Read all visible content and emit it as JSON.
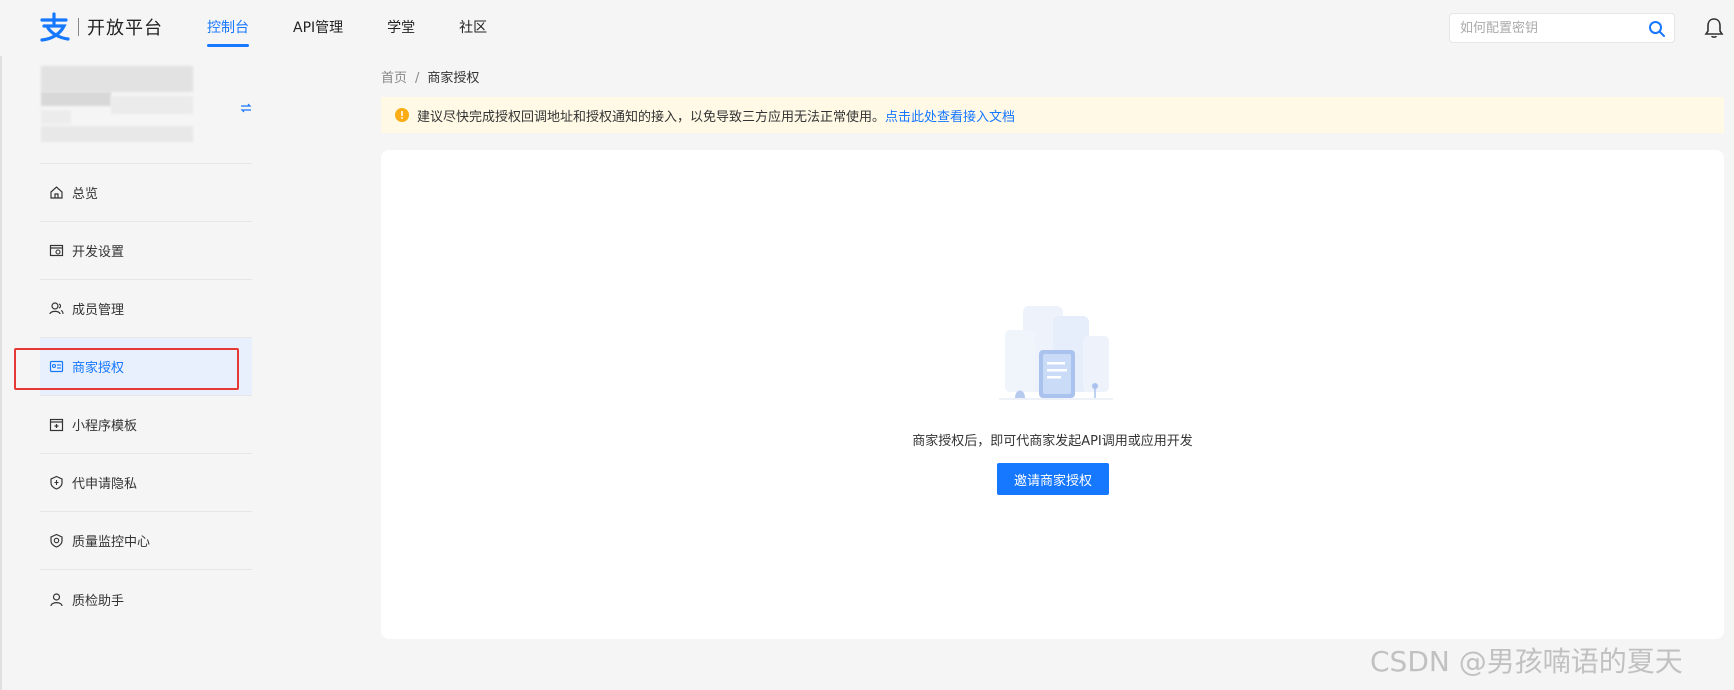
{
  "header": {
    "brand": "开放平台",
    "nav": [
      {
        "label": "控制台",
        "active": true
      },
      {
        "label": "API管理",
        "active": false
      },
      {
        "label": "学堂",
        "active": false
      },
      {
        "label": "社区",
        "active": false
      }
    ],
    "search_placeholder": "如何配置密钥"
  },
  "sidebar": {
    "items": [
      {
        "label": "总览",
        "icon": "home-icon"
      },
      {
        "label": "开发设置",
        "icon": "dev-settings-icon"
      },
      {
        "label": "成员管理",
        "icon": "members-icon"
      },
      {
        "label": "商家授权",
        "icon": "merchant-auth-icon",
        "active": true
      },
      {
        "label": "小程序模板",
        "icon": "template-icon"
      },
      {
        "label": "代申请隐私",
        "icon": "privacy-icon"
      },
      {
        "label": "质量监控中心",
        "icon": "quality-monitor-icon"
      },
      {
        "label": "质检助手",
        "icon": "inspector-icon"
      }
    ]
  },
  "breadcrumb": {
    "home": "首页",
    "separator": "/",
    "current": "商家授权"
  },
  "notice": {
    "text": "建议尽快完成授权回调地址和授权通知的接入，以免导致三方应用无法正常使用。",
    "link": "点击此处查看接入文档"
  },
  "empty_state": {
    "text": "商家授权后，即可代商家发起API调用或应用开发",
    "button": "邀请商家授权"
  },
  "watermark": "CSDN @男孩喃语的夏天",
  "colors": {
    "accent": "#1677ff",
    "notice_bg": "#fff9e6",
    "highlight": "#e53935"
  }
}
